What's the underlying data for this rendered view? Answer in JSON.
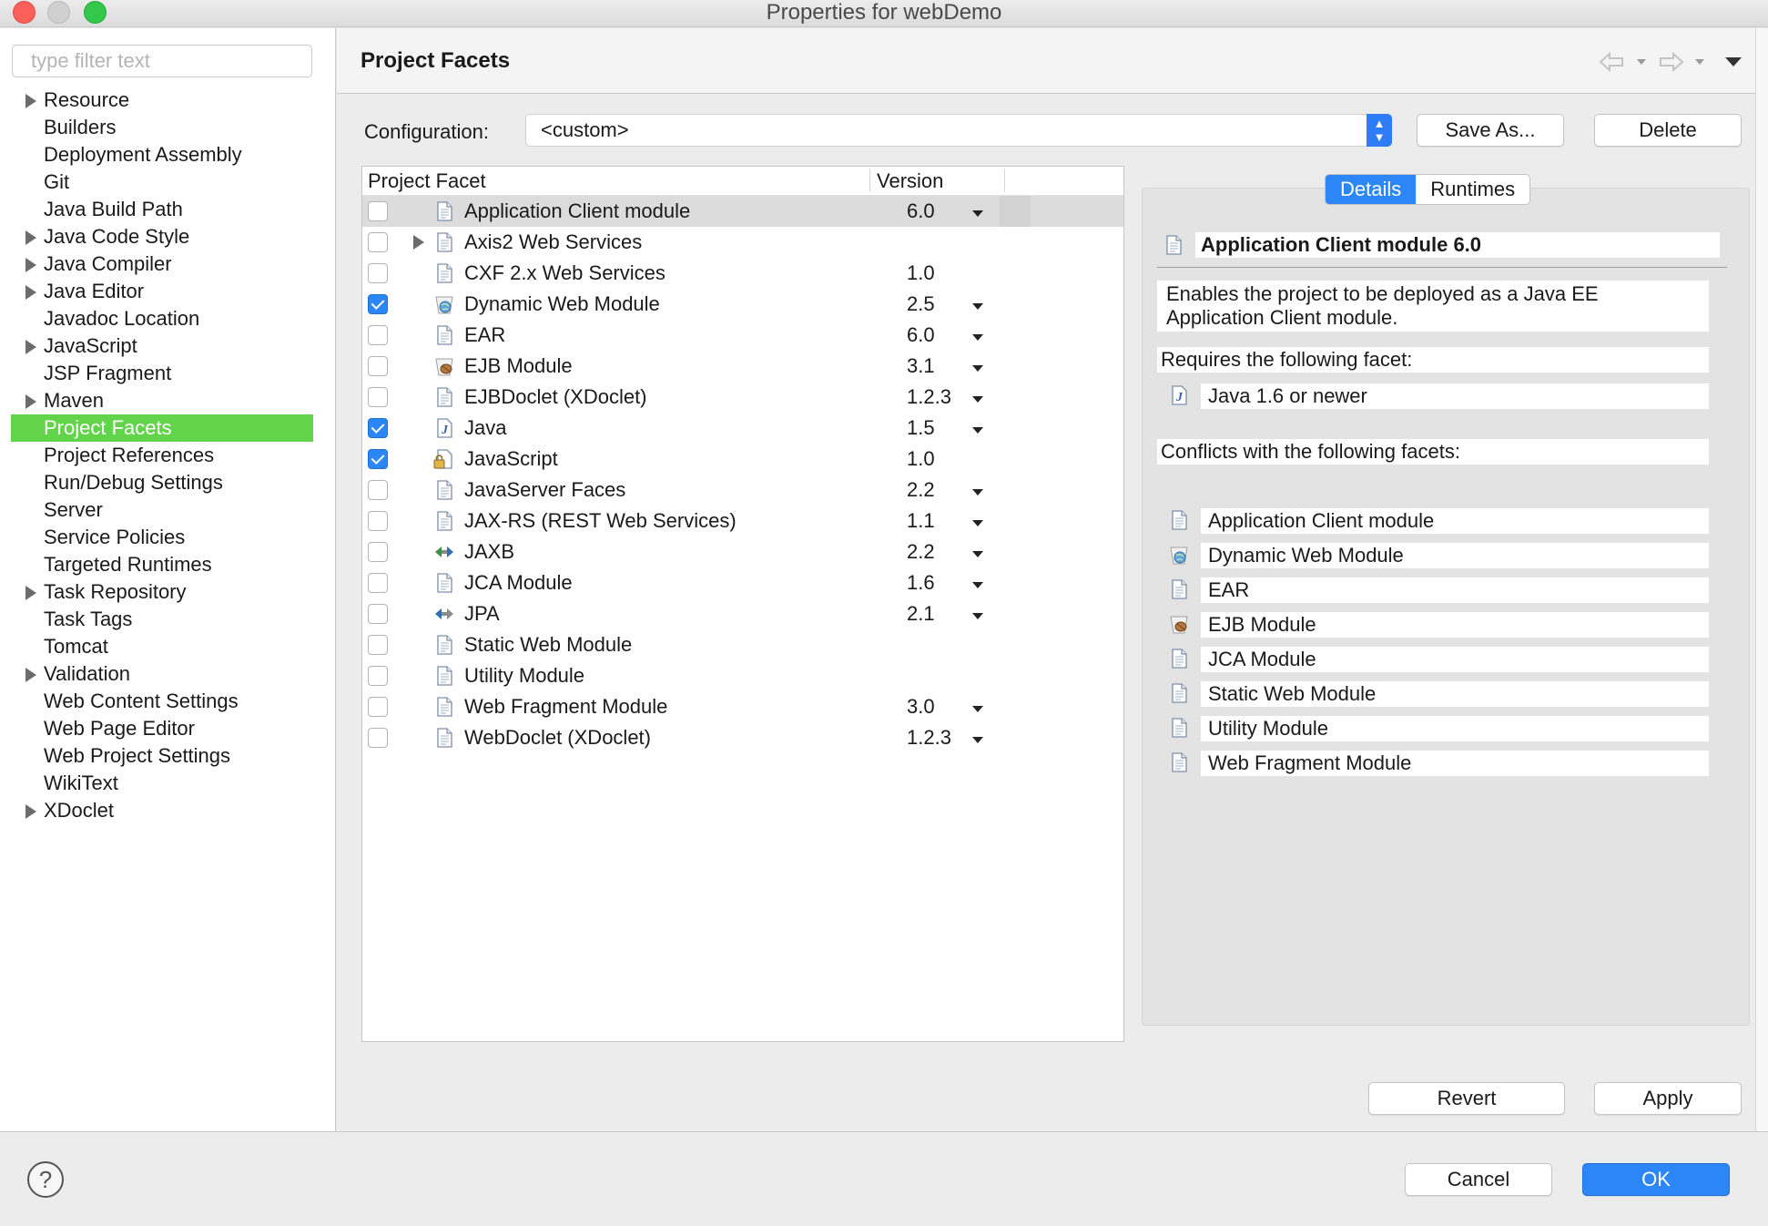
{
  "window": {
    "title": "Properties for webDemo"
  },
  "sidebar": {
    "filter_placeholder": "type filter text",
    "items": [
      {
        "label": "Resource",
        "expandable": true
      },
      {
        "label": "Builders",
        "expandable": false
      },
      {
        "label": "Deployment Assembly",
        "expandable": false
      },
      {
        "label": "Git",
        "expandable": false
      },
      {
        "label": "Java Build Path",
        "expandable": false
      },
      {
        "label": "Java Code Style",
        "expandable": true
      },
      {
        "label": "Java Compiler",
        "expandable": true
      },
      {
        "label": "Java Editor",
        "expandable": true
      },
      {
        "label": "Javadoc Location",
        "expandable": false
      },
      {
        "label": "JavaScript",
        "expandable": true
      },
      {
        "label": "JSP Fragment",
        "expandable": false
      },
      {
        "label": "Maven",
        "expandable": true
      },
      {
        "label": "Project Facets",
        "expandable": false,
        "selected": true
      },
      {
        "label": "Project References",
        "expandable": false
      },
      {
        "label": "Run/Debug Settings",
        "expandable": false
      },
      {
        "label": "Server",
        "expandable": false
      },
      {
        "label": "Service Policies",
        "expandable": false
      },
      {
        "label": "Targeted Runtimes",
        "expandable": false
      },
      {
        "label": "Task Repository",
        "expandable": true
      },
      {
        "label": "Task Tags",
        "expandable": false
      },
      {
        "label": "Tomcat",
        "expandable": false
      },
      {
        "label": "Validation",
        "expandable": true
      },
      {
        "label": "Web Content Settings",
        "expandable": false
      },
      {
        "label": "Web Page Editor",
        "expandable": false
      },
      {
        "label": "Web Project Settings",
        "expandable": false
      },
      {
        "label": "WikiText",
        "expandable": false
      },
      {
        "label": "XDoclet",
        "expandable": true
      }
    ]
  },
  "page": {
    "title": "Project Facets",
    "config_label": "Configuration:",
    "config_value": "<custom>",
    "save_as": "Save As...",
    "delete": "Delete",
    "revert": "Revert",
    "apply": "Apply"
  },
  "table": {
    "col_facet": "Project Facet",
    "col_version": "Version",
    "rows": [
      {
        "name": "Application Client module",
        "version": "6.0",
        "checked": false,
        "dropdown": true,
        "icon": "doc-icon",
        "selected": true
      },
      {
        "name": "Axis2 Web Services",
        "version": "",
        "checked": false,
        "dropdown": false,
        "icon": "doc-icon",
        "expandable": true
      },
      {
        "name": "CXF 2.x Web Services",
        "version": "1.0",
        "checked": false,
        "dropdown": false,
        "icon": "doc-icon"
      },
      {
        "name": "Dynamic Web Module",
        "version": "2.5",
        "checked": true,
        "dropdown": true,
        "icon": "web-module-icon"
      },
      {
        "name": "EAR",
        "version": "6.0",
        "checked": false,
        "dropdown": true,
        "icon": "doc-icon"
      },
      {
        "name": "EJB Module",
        "version": "3.1",
        "checked": false,
        "dropdown": true,
        "icon": "ejb-icon"
      },
      {
        "name": "EJBDoclet (XDoclet)",
        "version": "1.2.3",
        "checked": false,
        "dropdown": true,
        "icon": "doc-icon"
      },
      {
        "name": "Java",
        "version": "1.5",
        "checked": true,
        "dropdown": true,
        "icon": "java-icon"
      },
      {
        "name": "JavaScript",
        "version": "1.0",
        "checked": true,
        "dropdown": false,
        "icon": "javascript-lock-icon"
      },
      {
        "name": "JavaServer Faces",
        "version": "2.2",
        "checked": false,
        "dropdown": true,
        "icon": "doc-icon"
      },
      {
        "name": "JAX-RS (REST Web Services)",
        "version": "1.1",
        "checked": false,
        "dropdown": true,
        "icon": "doc-icon"
      },
      {
        "name": "JAXB",
        "version": "2.2",
        "checked": false,
        "dropdown": true,
        "icon": "jaxb-icon"
      },
      {
        "name": "JCA Module",
        "version": "1.6",
        "checked": false,
        "dropdown": true,
        "icon": "doc-icon"
      },
      {
        "name": "JPA",
        "version": "2.1",
        "checked": false,
        "dropdown": true,
        "icon": "jpa-icon"
      },
      {
        "name": "Static Web Module",
        "version": "",
        "checked": false,
        "dropdown": false,
        "icon": "doc-icon"
      },
      {
        "name": "Utility Module",
        "version": "",
        "checked": false,
        "dropdown": false,
        "icon": "doc-icon"
      },
      {
        "name": "Web Fragment Module",
        "version": "3.0",
        "checked": false,
        "dropdown": true,
        "icon": "doc-icon"
      },
      {
        "name": "WebDoclet (XDoclet)",
        "version": "1.2.3",
        "checked": false,
        "dropdown": true,
        "icon": "doc-icon"
      }
    ]
  },
  "details": {
    "tab_details": "Details",
    "tab_runtimes": "Runtimes",
    "title": "Application Client module 6.0",
    "description": "Enables the project to be deployed as a Java EE Application Client module.",
    "requires_label": "Requires the following facet:",
    "requires": [
      {
        "name": "Java 1.6 or newer",
        "icon": "java-icon"
      }
    ],
    "conflicts_label": "Conflicts with the following facets:",
    "conflicts": [
      {
        "name": "Application Client module",
        "icon": "doc-icon"
      },
      {
        "name": "Dynamic Web Module",
        "icon": "web-module-icon"
      },
      {
        "name": "EAR",
        "icon": "doc-icon"
      },
      {
        "name": "EJB Module",
        "icon": "ejb-icon"
      },
      {
        "name": "JCA Module",
        "icon": "doc-icon"
      },
      {
        "name": "Static Web Module",
        "icon": "doc-icon"
      },
      {
        "name": "Utility Module",
        "icon": "doc-icon"
      },
      {
        "name": "Web Fragment Module",
        "icon": "doc-icon"
      }
    ]
  },
  "footer": {
    "cancel": "Cancel",
    "ok": "OK"
  },
  "colors": {
    "selection_green": "#62d44a",
    "accent_blue": "#2c86f5"
  }
}
